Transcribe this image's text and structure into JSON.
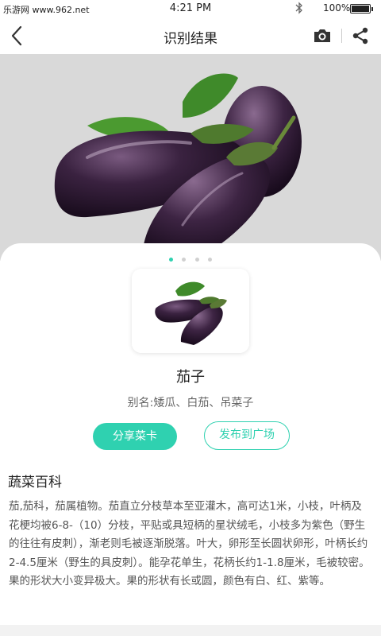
{
  "status_bar": {
    "left_text": "乐游网 www.962.net",
    "time": "4:21 PM",
    "battery": "100%"
  },
  "nav": {
    "title": "识别结果",
    "icons": [
      "back-arrow-icon",
      "camera-icon",
      "share-icon"
    ]
  },
  "carousel": {
    "page_count": 4,
    "active_index": 0
  },
  "result": {
    "name": "茄子",
    "alias_label": "别名:",
    "alias_value": "矮瓜、白茄、吊菜子"
  },
  "actions": {
    "share_card": "分享菜卡",
    "publish": "发布到广场"
  },
  "encyclopedia": {
    "title": "蔬菜百科",
    "text": "茄,茄科，茄属植物。茄直立分枝草本至亚灌木，高可达1米，小枝，叶柄及花梗均被6-8-（10）分枝，平贴或具短柄的星状绒毛，小枝多为紫色（野生的往往有皮刺），渐老则毛被逐渐脱落。叶大，卵形至长圆状卵形，叶柄长约2-4.5厘米（野生的具皮刺）。能孕花单生，花柄长约1-1.8厘米，毛被较密。果的形状大小变异极大。果的形状有长或圆，颜色有白、红、紫等。"
  },
  "colors": {
    "accent": "#2fd1b0",
    "hero_bg": "#d9d9d9"
  }
}
